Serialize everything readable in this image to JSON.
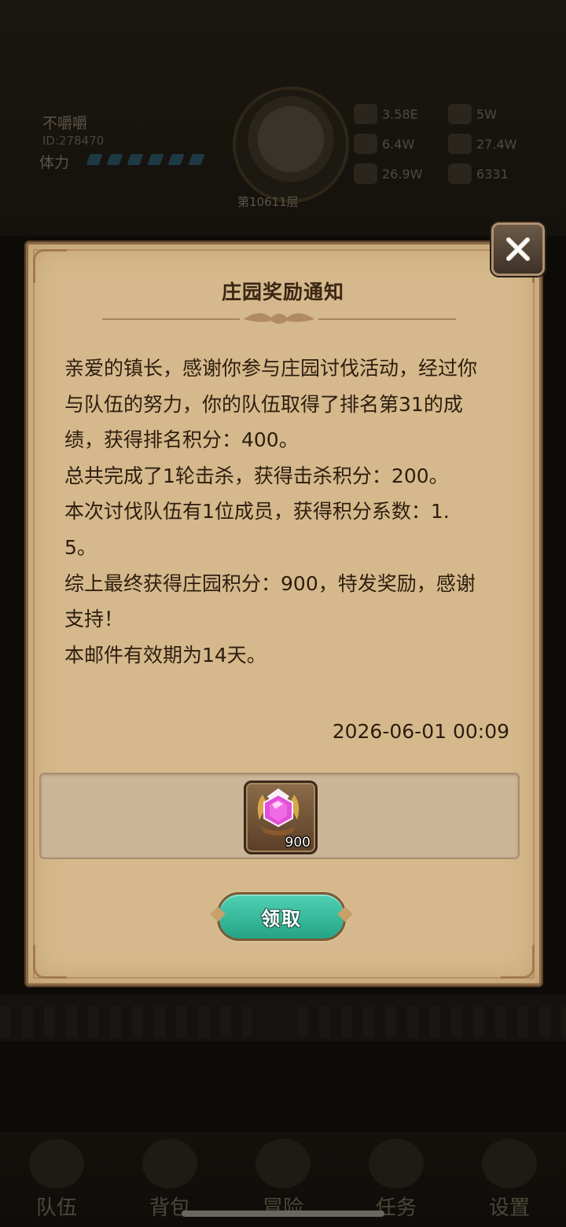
{
  "background": {
    "player_name": "不嚼嚼",
    "player_id": "ID:278470",
    "stamina_label": "体力",
    "level_text": "第10611层",
    "resources": [
      "3.58E",
      "5W",
      "6.4W",
      "27.4W",
      "26.9W",
      "6331"
    ],
    "nav": [
      "队伍",
      "背包",
      "冒险",
      "任务",
      "设置"
    ]
  },
  "dialog": {
    "title": "庄园奖励通知",
    "body": "亲爱的镇长，感谢你参与庄园讨伐活动，经过你与队伍的努力，你的队伍取得了排名第31的成绩，获得排名积分：400。\n总共完成了1轮击杀，获得击杀积分：200。\n本次讨伐队伍有1位成员，获得积分系数：1.5。\n综上最终获得庄园积分：900，特发奖励，感谢支持！\n本邮件有效期为14天。",
    "date": "2026-06-01 00:09",
    "reward": {
      "icon": "pink-gem-icon",
      "count": "900"
    },
    "claim_label": "领取"
  },
  "colors": {
    "parchment": "#d5b98c",
    "claim_button": "#36b898",
    "text": "#2d1d0f"
  }
}
